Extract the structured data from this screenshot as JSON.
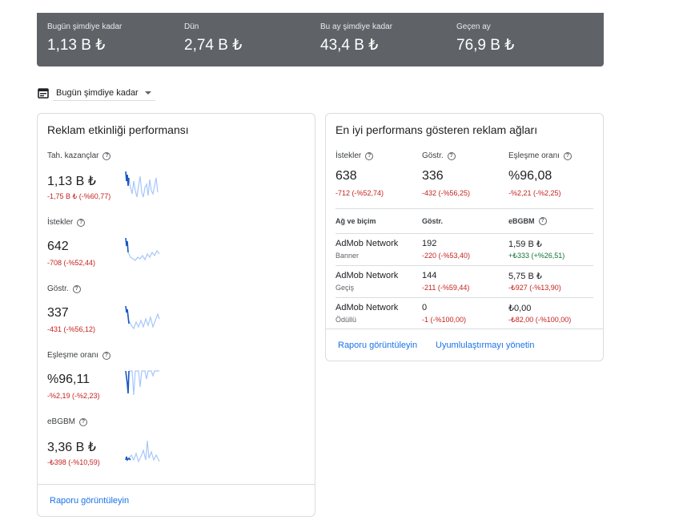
{
  "summary": [
    {
      "label": "Bugün şimdiye kadar",
      "value": "1,13 B ₺"
    },
    {
      "label": "Dün",
      "value": "2,74 B ₺"
    },
    {
      "label": "Bu ay şimdiye kadar",
      "value": "43,4 B ₺"
    },
    {
      "label": "Geçen ay",
      "value": "76,9 B ₺"
    }
  ],
  "date_selector": {
    "label": "Bugün şimdiye kadar"
  },
  "ad_activity": {
    "title": "Reklam etkinliği performansı",
    "metrics": [
      {
        "label": "Tah. kazançlar",
        "value": "1,13 B ₺",
        "delta": "-1,75 B ₺ (-%60,77)"
      },
      {
        "label": "İstekler",
        "value": "642",
        "delta": "-708 (-%52,44)"
      },
      {
        "label": "Göstr.",
        "value": "337",
        "delta": "-431 (-%56,12)"
      },
      {
        "label": "Eşleşme oranı",
        "value": "%96,11",
        "delta": "-%2,19 (-%2,23)"
      },
      {
        "label": "eBGBM",
        "value": "3,36 B ₺",
        "delta": "-₺398 (-%10,59)"
      }
    ],
    "link": "Raporu görüntüleyin"
  },
  "top_networks": {
    "title": "En iyi performans gösteren reklam ağları",
    "metrics": [
      {
        "label": "İstekler",
        "value": "638",
        "delta": "-712 (-%52,74)"
      },
      {
        "label": "Göstr.",
        "value": "336",
        "delta": "-432 (-%56,25)"
      },
      {
        "label": "Eşleşme oranı",
        "value": "%96,08",
        "delta": "-%2,21 (-%2,25)"
      }
    ],
    "table": {
      "headers": [
        "Ağ ve biçim",
        "Göstr.",
        "eBGBM"
      ],
      "rows": [
        {
          "network": "AdMob Network",
          "format": "Banner",
          "impr": "192",
          "impr_delta": "-220 (-%53,40)",
          "ecpm": "1,59 B ₺",
          "ecpm_delta": "+₺333 (+%26,51)"
        },
        {
          "network": "AdMob Network",
          "format": "Geçiş",
          "impr": "144",
          "impr_delta": "-211 (-%59,44)",
          "ecpm": "5,75 B ₺",
          "ecpm_delta": "-₺927 (-%13,90)"
        },
        {
          "network": "AdMob Network",
          "format": "Ödüllü",
          "impr": "0",
          "impr_delta": "-1 (-%100,00)",
          "ecpm": "₺0,00",
          "ecpm_delta": "-₺82,00 (-%100,00)"
        }
      ]
    },
    "links": [
      "Raporu görüntüleyin",
      "Uyumlulaştırmayı yönetin"
    ]
  },
  "colors": {
    "summary_bg": "#5f6368",
    "negative": "#c5221f",
    "positive": "#137333",
    "link": "#1a73e8",
    "spark_dark": "#1a56c4",
    "spark_light": "#a8c7fa"
  }
}
